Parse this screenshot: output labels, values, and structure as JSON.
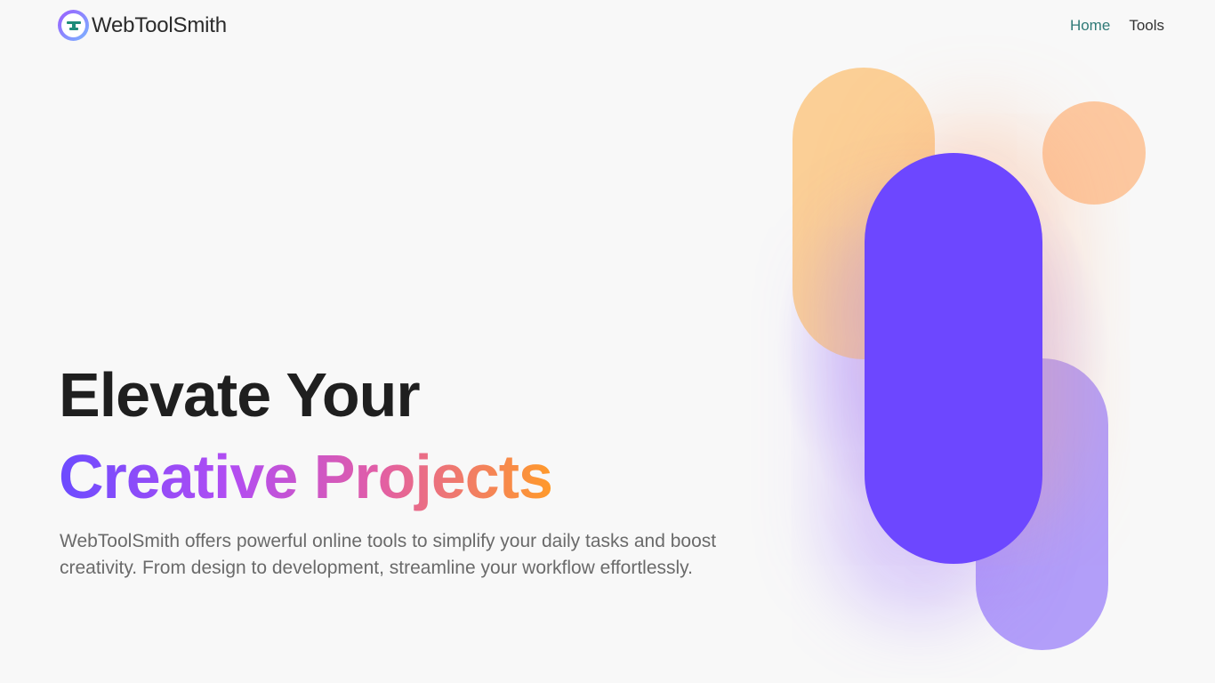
{
  "brand": {
    "name": "WebToolSmith"
  },
  "nav": {
    "home": "Home",
    "tools": "Tools"
  },
  "hero": {
    "title_line1": "Elevate Your",
    "title_line2": "Creative Projects",
    "description": "WebToolSmith offers powerful online tools to simplify your daily tasks and boost creativity. From design to development, streamline your workflow effortlessly."
  },
  "colors": {
    "accent_nav": "#2f7a77",
    "purple": "#6d47ff",
    "lavender": "#b29ef9",
    "orange": "#fbcf96",
    "peach": "#fcc8a0"
  }
}
